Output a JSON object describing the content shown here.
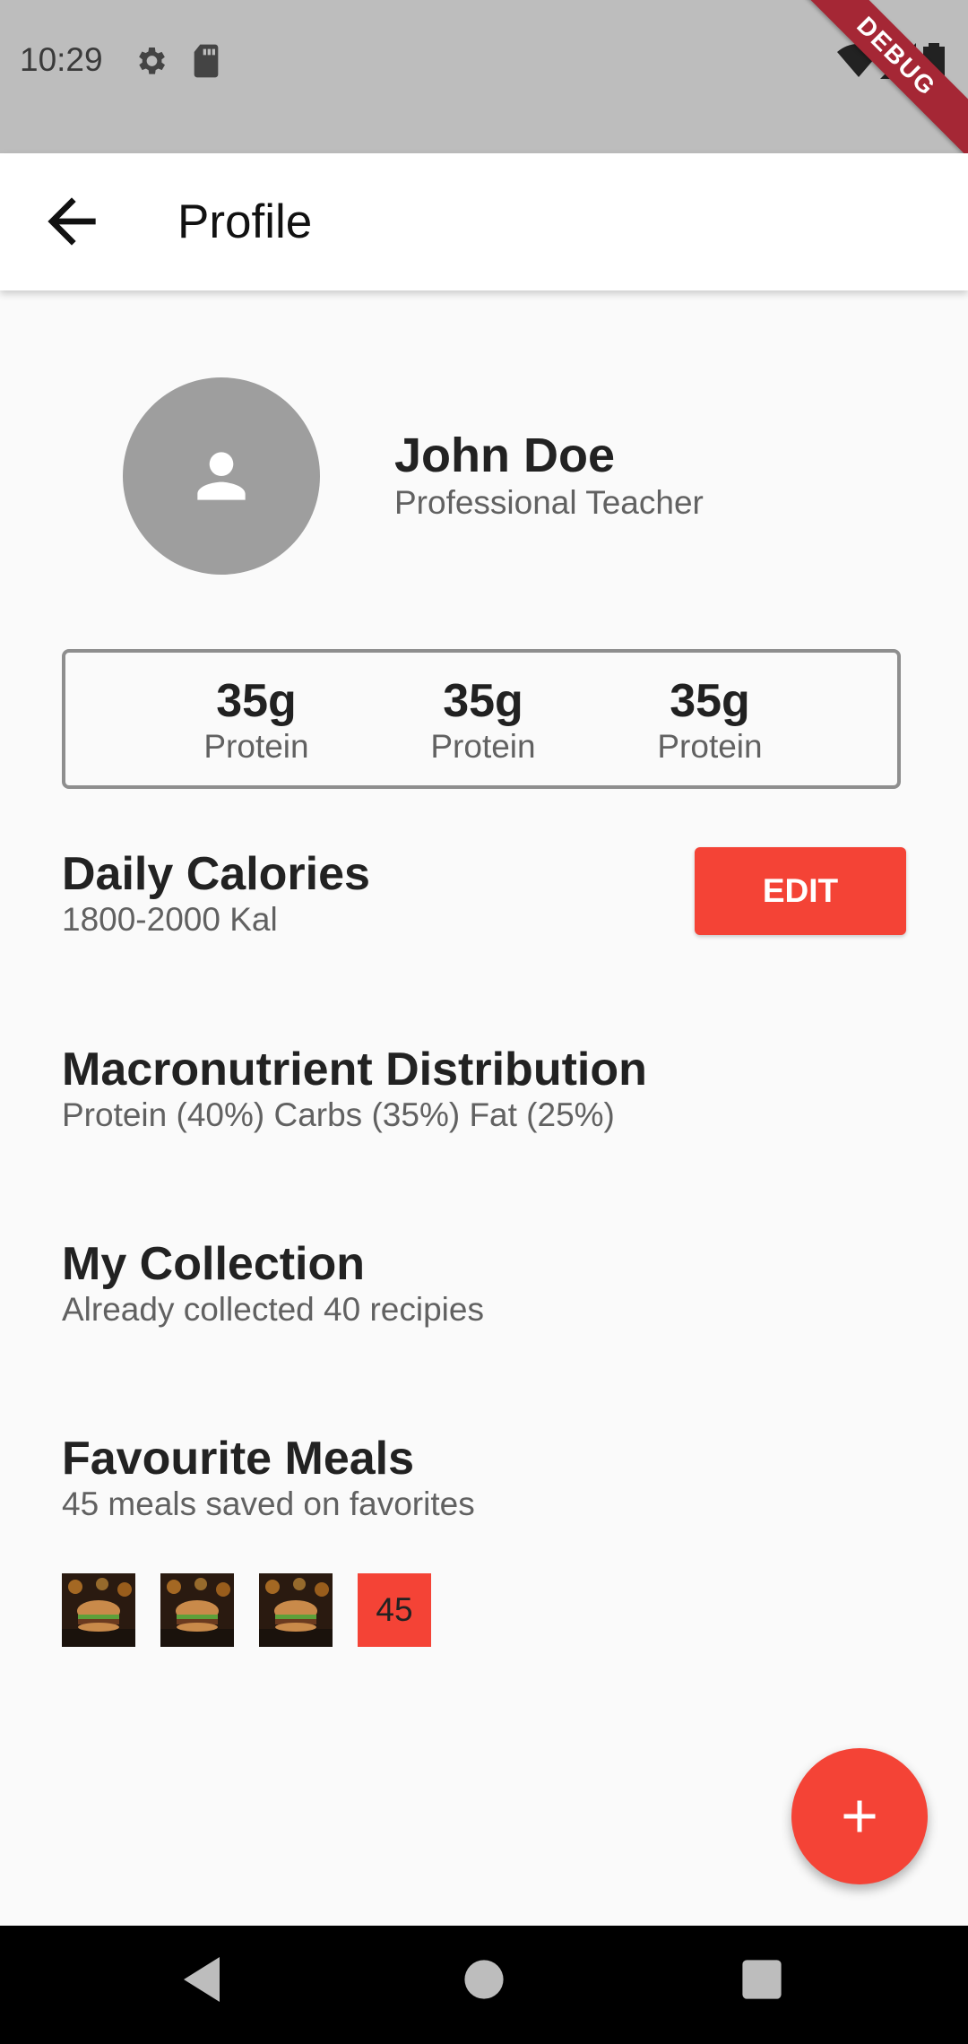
{
  "status_bar": {
    "time": "10:29",
    "icons": [
      "gear-icon",
      "sd-card-icon",
      "wifi-icon",
      "signal-icon",
      "battery-icon"
    ],
    "debug_label": "DEBUG"
  },
  "app_bar": {
    "title": "Profile",
    "back_icon": "arrow-back-icon"
  },
  "profile": {
    "name": "John Doe",
    "role": "Professional Teacher",
    "avatar_icon": "person-icon"
  },
  "stats": [
    {
      "value": "35g",
      "label": "Protein"
    },
    {
      "value": "35g",
      "label": "Protein"
    },
    {
      "value": "35g",
      "label": "Protein"
    }
  ],
  "daily_calories": {
    "title": "Daily Calories",
    "subtitle": "1800-2000 Kal",
    "button_label": "EDIT"
  },
  "macros": {
    "title": "Macronutrient Distribution",
    "subtitle": "Protein (40%) Carbs (35%) Fat (25%)"
  },
  "collection": {
    "title": "My Collection",
    "subtitle": "Already collected 40 recipies"
  },
  "favourites": {
    "title": "Favourite Meals",
    "subtitle": "45 meals saved on favorites",
    "count": "45"
  },
  "fab_icon": "plus-icon",
  "nav": [
    "back-triangle-icon",
    "home-circle-icon",
    "recents-square-icon"
  ],
  "colors": {
    "accent": "#f44336",
    "status_bar": "#bdbdbd",
    "background": "#fafafa"
  }
}
